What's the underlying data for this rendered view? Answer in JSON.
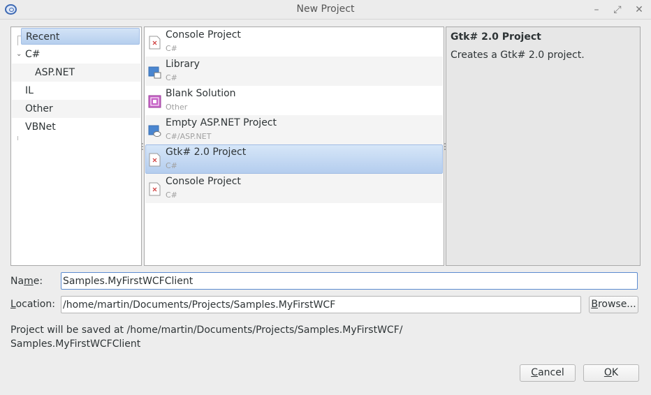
{
  "window": {
    "title": "New Project"
  },
  "categories": [
    {
      "label": "Recent",
      "selected": true
    },
    {
      "label": "C#",
      "expanded": true
    },
    {
      "label": "ASP.NET",
      "child": true
    },
    {
      "label": "IL"
    },
    {
      "label": "Other"
    },
    {
      "label": "VBNet"
    }
  ],
  "templates": [
    {
      "name": "Console Project",
      "language": "C#",
      "icon": "console-project-icon"
    },
    {
      "name": "Library",
      "language": "C#",
      "icon": "library-icon"
    },
    {
      "name": "Blank Solution",
      "language": "Other",
      "icon": "blank-solution-icon"
    },
    {
      "name": "Empty ASP.NET Project",
      "language": "C#/ASP.NET",
      "icon": "aspnet-project-icon"
    },
    {
      "name": "Gtk# 2.0 Project",
      "language": "C#",
      "icon": "gtk-project-icon",
      "selected": true
    },
    {
      "name": "Console Project",
      "language": "C#",
      "icon": "console-project-icon"
    }
  ],
  "description": {
    "title": "Gtk# 2.0 Project",
    "text": "Creates a Gtk# 2.0 project."
  },
  "form": {
    "name_label_pre": "Na",
    "name_label_mnemonic": "m",
    "name_label_post": "e:",
    "name_value": "Samples.MyFirstWCFClient",
    "location_label_mnemonic": "L",
    "location_label_post": "ocation:",
    "location_value": "/home/martin/Documents/Projects/Samples.MyFirstWCF",
    "browse_label_mnemonic": "B",
    "browse_label_post": "rowse..."
  },
  "save_info": {
    "line1": "Project will be saved at /home/martin/Documents/Projects/Samples.MyFirstWCF/",
    "line2": "Samples.MyFirstWCFClient"
  },
  "buttons": {
    "cancel_mnemonic": "C",
    "cancel_post": "ancel",
    "ok_mnemonic": "O",
    "ok_post": "K"
  },
  "colors": {
    "selection": "#b6cfee",
    "focus": "#5b8bd0",
    "description_bg": "#e7e7e7"
  }
}
